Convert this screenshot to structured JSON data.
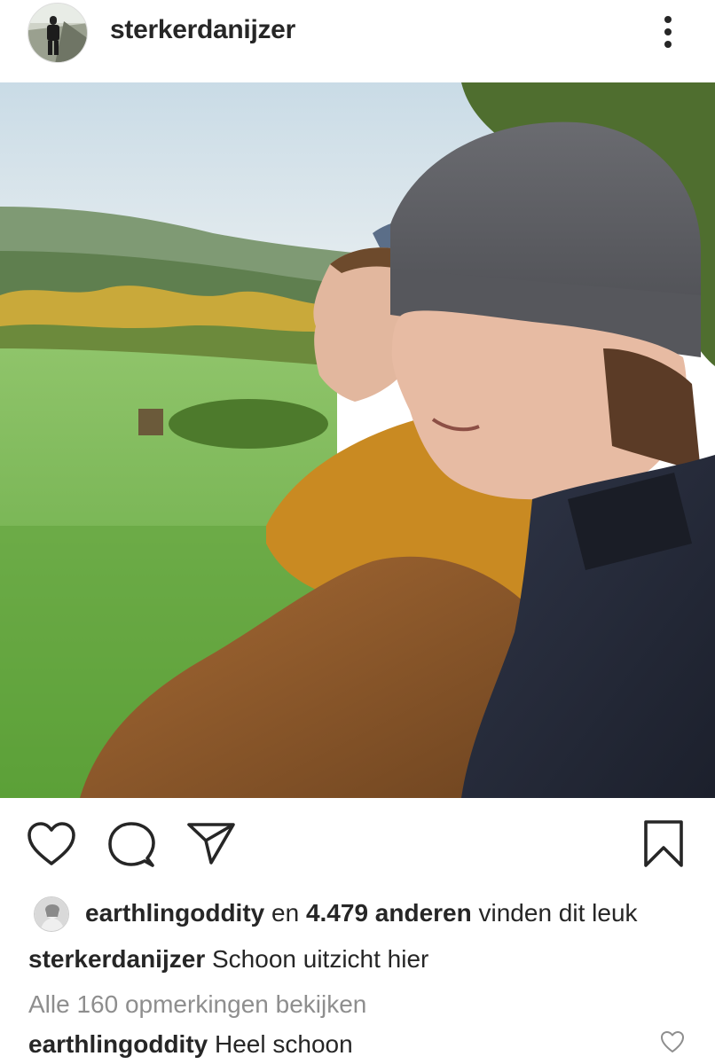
{
  "post": {
    "author": "sterkerdanijzer",
    "avatar_icon": "profile-photo",
    "more_icon": "more-vertical-icon"
  },
  "photo": {
    "kind": "photo"
  },
  "actions": {
    "like_icon": "heart-outline-icon",
    "comment_icon": "comment-bubble-icon",
    "share_icon": "paper-plane-icon",
    "save_icon": "bookmark-outline-icon"
  },
  "likes": {
    "user": "earthlingoddity",
    "connector": "en",
    "others": "4.479 anderen",
    "suffix": "vinden dit leuk"
  },
  "caption": {
    "user": "sterkerdanijzer",
    "text": "Schoon uitzicht hier"
  },
  "view_all_comments": "Alle 160 opmerkingen bekijken",
  "comments": [
    {
      "user": "earthlingoddity",
      "text": "Heel schoon"
    }
  ],
  "colors": {
    "text": "#262626",
    "muted": "#8e8e8e",
    "background": "#ffffff"
  }
}
